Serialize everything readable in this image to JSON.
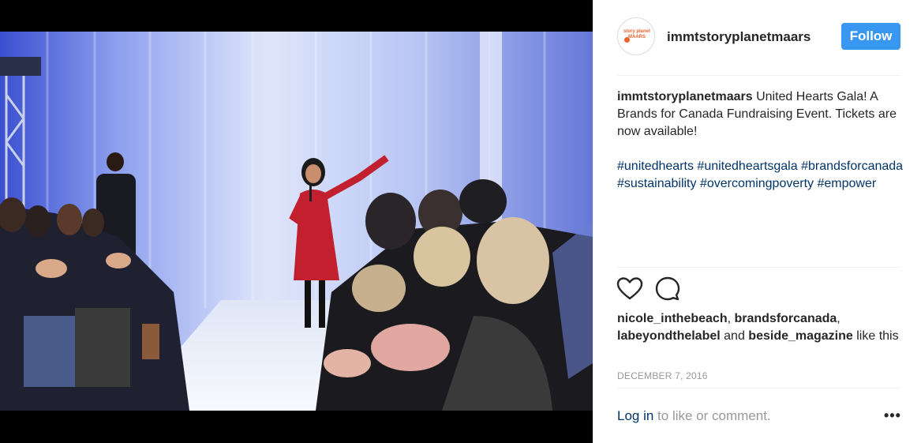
{
  "header": {
    "username": "immtstoryplanetmaars",
    "avatar_text": "story planet MAARS",
    "follow_label": "Follow"
  },
  "caption": {
    "username": "immtstoryplanetmaars",
    "text": " United Hearts Gala! A Brands for Canada Fundraising Event. Tickets are now available!",
    "hashtags": [
      "#unitedhearts",
      "#unitedheartsgala",
      "#brandsforcanada",
      "#sustainability",
      "#overcomingpoverty",
      "#empower"
    ]
  },
  "likes": {
    "user1": "nicole_inthebeach",
    "sep1": ", ",
    "user2": "brandsforcanada",
    "sep2": ", ",
    "user3": "labeyondthelabel",
    "and": " and ",
    "user4": "beside_magazine",
    "suffix": " like this"
  },
  "date": "DECEMBER 7, 2016",
  "footer": {
    "login_link": "Log in",
    "login_text": " to like or comment.",
    "more": "•••"
  },
  "icons": {
    "like": "heart-icon",
    "comment": "comment-bubble-icon",
    "more": "more-options-icon"
  },
  "colors": {
    "follow_button": "#3897f0",
    "link": "#003569",
    "muted": "#999999"
  }
}
